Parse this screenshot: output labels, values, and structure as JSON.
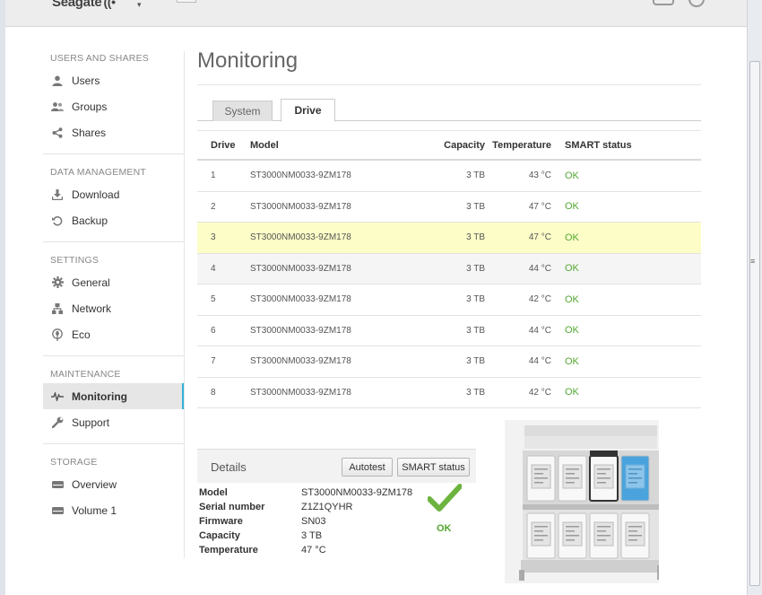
{
  "app": {
    "brand": "Seagate"
  },
  "sidebar": {
    "sections": [
      {
        "title": "USERS AND SHARES",
        "items": [
          {
            "label": "Users",
            "icon": "user-icon"
          },
          {
            "label": "Groups",
            "icon": "groups-icon"
          },
          {
            "label": "Shares",
            "icon": "share-icon"
          }
        ]
      },
      {
        "title": "DATA MANAGEMENT",
        "items": [
          {
            "label": "Download",
            "icon": "download-icon"
          },
          {
            "label": "Backup",
            "icon": "backup-icon"
          }
        ]
      },
      {
        "title": "SETTINGS",
        "items": [
          {
            "label": "General",
            "icon": "gear-icon"
          },
          {
            "label": "Network",
            "icon": "network-icon"
          },
          {
            "label": "Eco",
            "icon": "eco-icon"
          }
        ]
      },
      {
        "title": "MAINTENANCE",
        "items": [
          {
            "label": "Monitoring",
            "icon": "monitoring-icon",
            "active": true
          },
          {
            "label": "Support",
            "icon": "wrench-icon"
          }
        ]
      },
      {
        "title": "STORAGE",
        "items": [
          {
            "label": "Overview",
            "icon": "disk-icon"
          },
          {
            "label": "Volume 1",
            "icon": "disk-icon"
          }
        ]
      }
    ]
  },
  "main": {
    "title": "Monitoring",
    "tabs": [
      {
        "label": "System",
        "active": false
      },
      {
        "label": "Drive",
        "active": true
      }
    ],
    "table": {
      "headers": {
        "drive": "Drive",
        "model": "Model",
        "capacity": "Capacity",
        "temperature": "Temperature",
        "smart": "SMART status"
      },
      "rows": [
        {
          "drive": "1",
          "model": "ST3000NM0033-9ZM178",
          "capacity": "3 TB",
          "temperature": "43 °C",
          "smart": "OK"
        },
        {
          "drive": "2",
          "model": "ST3000NM0033-9ZM178",
          "capacity": "3 TB",
          "temperature": "47 °C",
          "smart": "OK"
        },
        {
          "drive": "3",
          "model": "ST3000NM0033-9ZM178",
          "capacity": "3 TB",
          "temperature": "47 °C",
          "smart": "OK"
        },
        {
          "drive": "4",
          "model": "ST3000NM0033-9ZM178",
          "capacity": "3 TB",
          "temperature": "44 °C",
          "smart": "OK"
        },
        {
          "drive": "5",
          "model": "ST3000NM0033-9ZM178",
          "capacity": "3 TB",
          "temperature": "42 °C",
          "smart": "OK"
        },
        {
          "drive": "6",
          "model": "ST3000NM0033-9ZM178",
          "capacity": "3 TB",
          "temperature": "44 °C",
          "smart": "OK"
        },
        {
          "drive": "7",
          "model": "ST3000NM0033-9ZM178",
          "capacity": "3 TB",
          "temperature": "44 °C",
          "smart": "OK"
        },
        {
          "drive": "8",
          "model": "ST3000NM0033-9ZM178",
          "capacity": "3 TB",
          "temperature": "42 °C",
          "smart": "OK"
        }
      ],
      "selected_drive": "3"
    },
    "details": {
      "title": "Details",
      "autotest_label": "Autotest",
      "smart_label": "SMART status",
      "fields": [
        {
          "key": "Model",
          "value": "ST3000NM0033-9ZM178"
        },
        {
          "key": "Serial number",
          "value": "Z1Z1QYHR"
        },
        {
          "key": "Firmware",
          "value": "SN03"
        },
        {
          "key": "Capacity",
          "value": "3 TB"
        },
        {
          "key": "Temperature",
          "value": "47 °C"
        }
      ],
      "status": "OK"
    }
  },
  "colors": {
    "accent": "#36b0d8",
    "ok": "#54a832",
    "highlight": "#fdfdc8",
    "selected_bay": "#4aa3dc"
  }
}
